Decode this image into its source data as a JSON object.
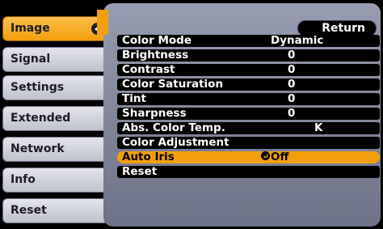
{
  "tabs": [
    {
      "label": "Image",
      "selected": true
    },
    {
      "label": "Signal",
      "selected": false
    },
    {
      "label": "Settings",
      "selected": false
    },
    {
      "label": "Extended",
      "selected": false
    },
    {
      "label": "Network",
      "selected": false
    },
    {
      "label": "Info",
      "selected": false
    },
    {
      "label": "Reset",
      "selected": false
    }
  ],
  "return_label": "Return",
  "items": [
    {
      "label": "Color Mode",
      "value": "Dynamic"
    },
    {
      "label": "Brightness",
      "value": "0"
    },
    {
      "label": "Contrast",
      "value": "0"
    },
    {
      "label": "Color Saturation",
      "value": "0"
    },
    {
      "label": "Tint",
      "value": "0"
    },
    {
      "label": "Sharpness",
      "value": "0"
    },
    {
      "label": "Abs. Color Temp.",
      "value": "K"
    },
    {
      "label": "Color Adjustment",
      "value": ""
    },
    {
      "label": "Auto Iris",
      "value": "Off",
      "selected": true
    },
    {
      "label": "Reset",
      "value": ""
    }
  ],
  "colors": {
    "accent": "#f39f0d",
    "panel": "#8a8ea2",
    "tab": "#d4d6de"
  },
  "icons": {
    "tab_enter": "enter-icon",
    "value_enter": "enter-icon"
  }
}
